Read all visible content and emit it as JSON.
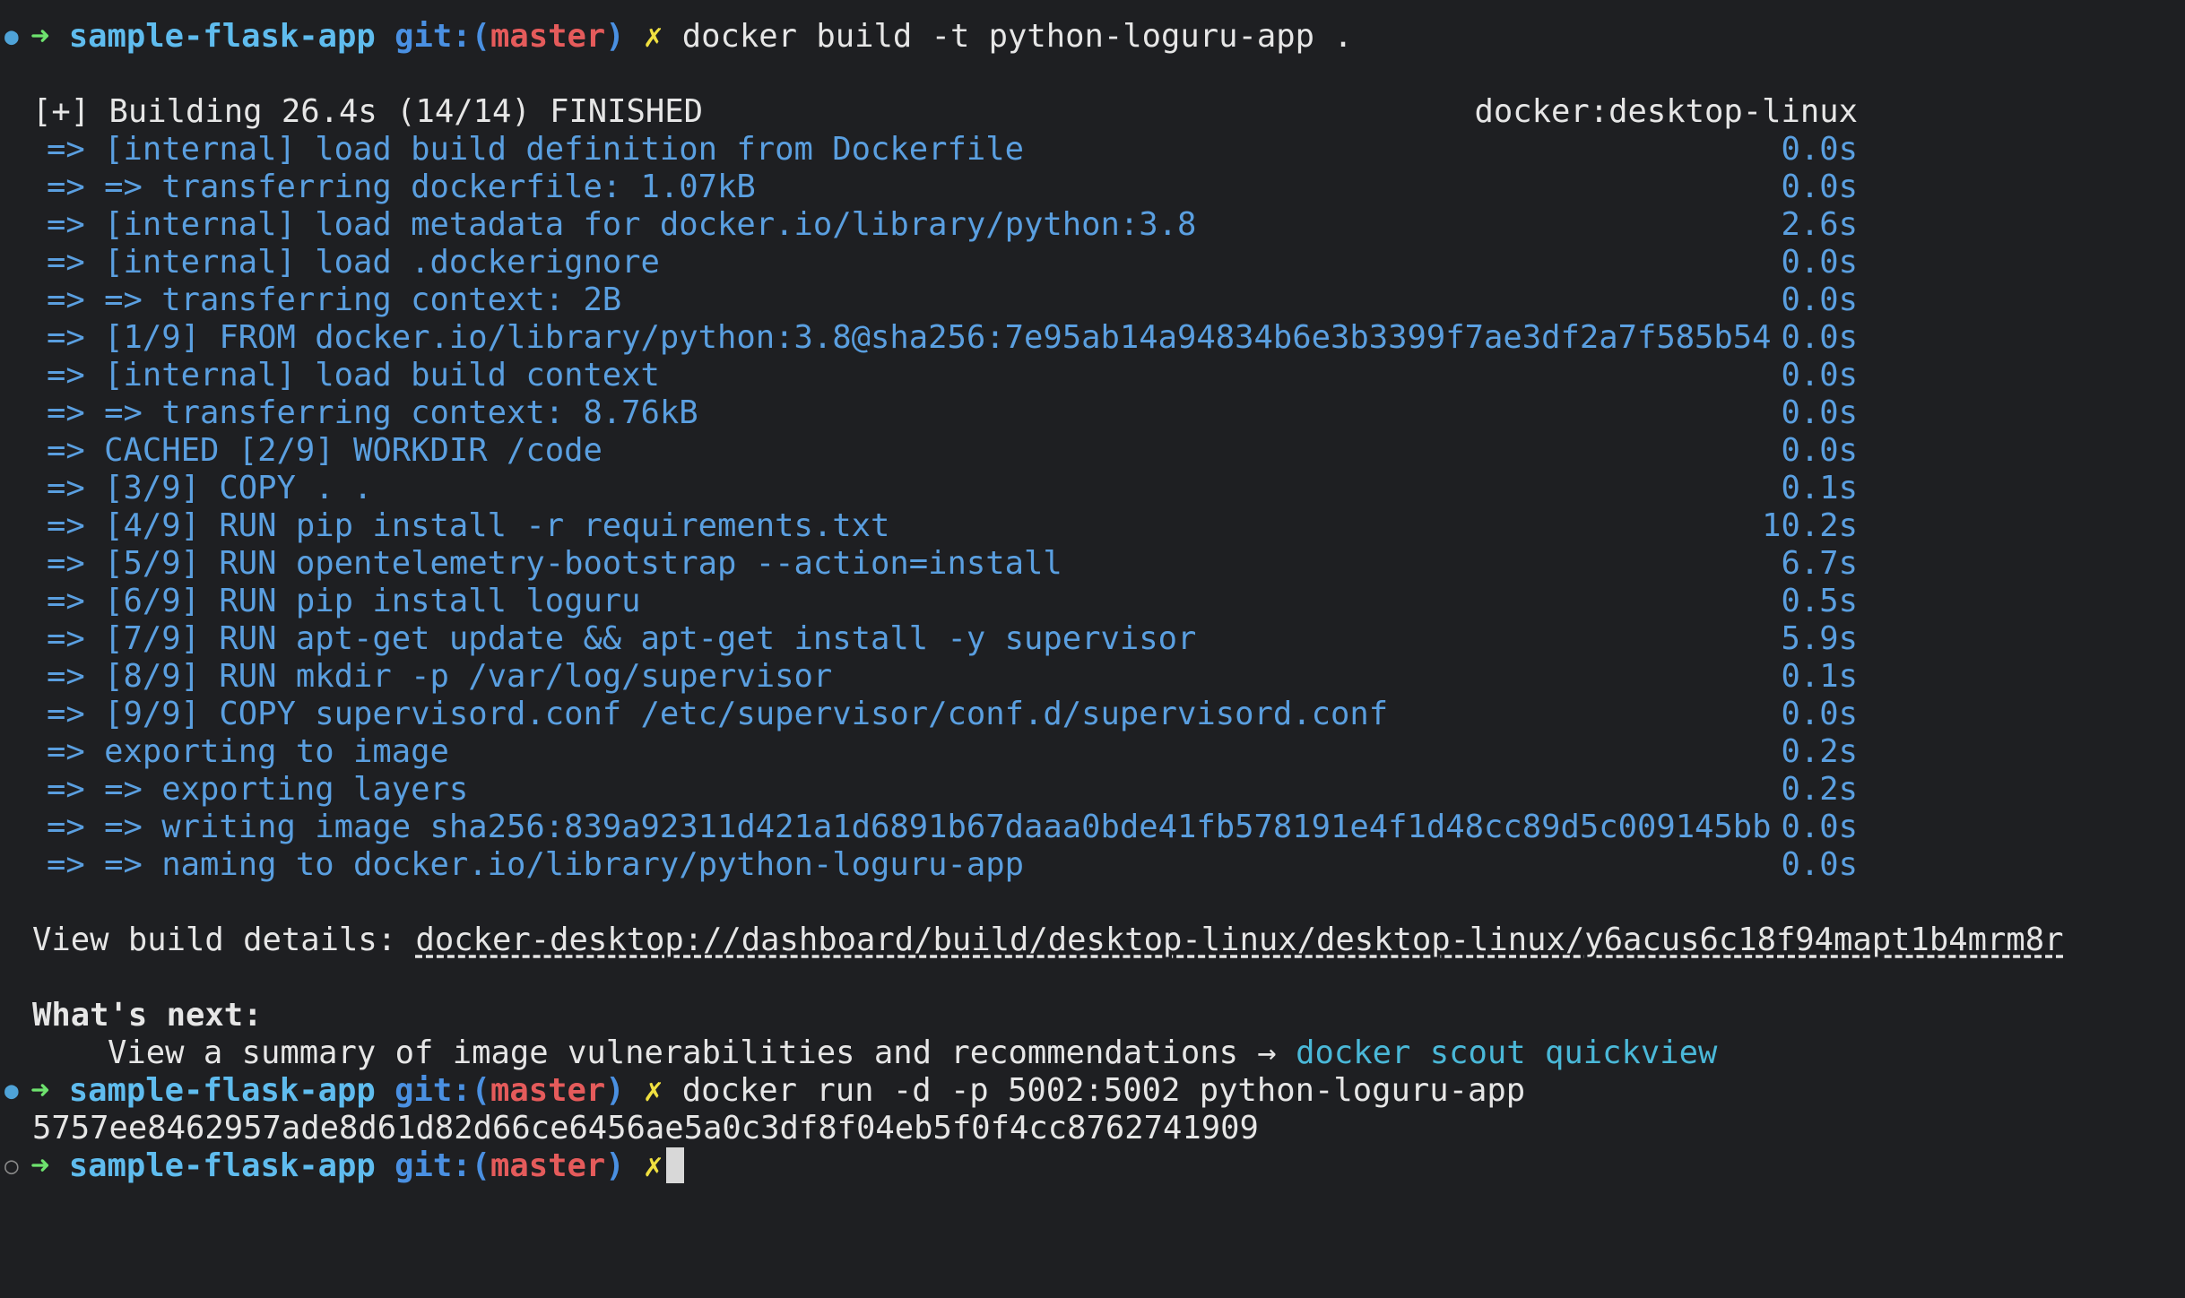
{
  "prompt": {
    "arrow": "➜",
    "dir": "sample-flask-app",
    "git_open": "git:(",
    "branch": "master",
    "git_close": ")",
    "dirty": "✗"
  },
  "commands": {
    "build": "docker build -t python-loguru-app .",
    "run": "docker run -d -p 5002:5002 python-loguru-app"
  },
  "build": {
    "header": "[+] Building 26.4s (14/14) FINISHED",
    "context": "docker:desktop-linux",
    "steps": [
      {
        "text": "=> [internal] load build definition from Dockerfile",
        "time": "0.0s"
      },
      {
        "text": "=> => transferring dockerfile: 1.07kB",
        "time": "0.0s"
      },
      {
        "text": "=> [internal] load metadata for docker.io/library/python:3.8",
        "time": "2.6s"
      },
      {
        "text": "=> [internal] load .dockerignore",
        "time": "0.0s"
      },
      {
        "text": "=> => transferring context: 2B",
        "time": "0.0s"
      },
      {
        "text": "=> [1/9] FROM docker.io/library/python:3.8@sha256:7e95ab14a94834b6e3b3399f7ae3df2a7f585b54",
        "time": "0.0s"
      },
      {
        "text": "=> [internal] load build context",
        "time": "0.0s"
      },
      {
        "text": "=> => transferring context: 8.76kB",
        "time": "0.0s"
      },
      {
        "text": "=> CACHED [2/9] WORKDIR /code",
        "time": "0.0s"
      },
      {
        "text": "=> [3/9] COPY . .",
        "time": "0.1s"
      },
      {
        "text": "=> [4/9] RUN pip install -r requirements.txt",
        "time": "10.2s"
      },
      {
        "text": "=> [5/9] RUN opentelemetry-bootstrap --action=install",
        "time": "6.7s"
      },
      {
        "text": "=> [6/9] RUN pip install loguru",
        "time": "0.5s"
      },
      {
        "text": "=> [7/9] RUN apt-get update && apt-get install -y supervisor",
        "time": "5.9s"
      },
      {
        "text": "=> [8/9] RUN mkdir -p /var/log/supervisor",
        "time": "0.1s"
      },
      {
        "text": "=> [9/9] COPY supervisord.conf /etc/supervisor/conf.d/supervisord.conf",
        "time": "0.0s"
      },
      {
        "text": "=> exporting to image",
        "time": "0.2s"
      },
      {
        "text": "=> => exporting layers",
        "time": "0.2s"
      },
      {
        "text": "=> => writing image sha256:839a92311d421a1d6891b67daaa0bde41fb578191e4f1d48cc89d5c009145bb",
        "time": "0.0s"
      },
      {
        "text": "=> => naming to docker.io/library/python-loguru-app",
        "time": "0.0s"
      }
    ]
  },
  "details": {
    "label": "View build details: ",
    "url": "docker-desktop://dashboard/build/desktop-linux/desktop-linux/y6acus6c18f94mapt1b4mrm8r"
  },
  "next": {
    "heading": "What's next:",
    "text": "View a summary of image vulnerabilities and recommendations → ",
    "cmd": "docker scout quickview"
  },
  "container_id": "5757ee8462957ade8d61d82d66ce6456ae5a0c3df8f04eb5f0f4cc8762741909",
  "gutter": {
    "filled": "●",
    "hollow": "○"
  },
  "colors": {
    "background": "#1e1f22",
    "arrow": "#6ee26e",
    "dir": "#5fbcee",
    "branch": "#e55b5b",
    "dirty": "#f0e040",
    "build_step": "#5a9fe0"
  }
}
